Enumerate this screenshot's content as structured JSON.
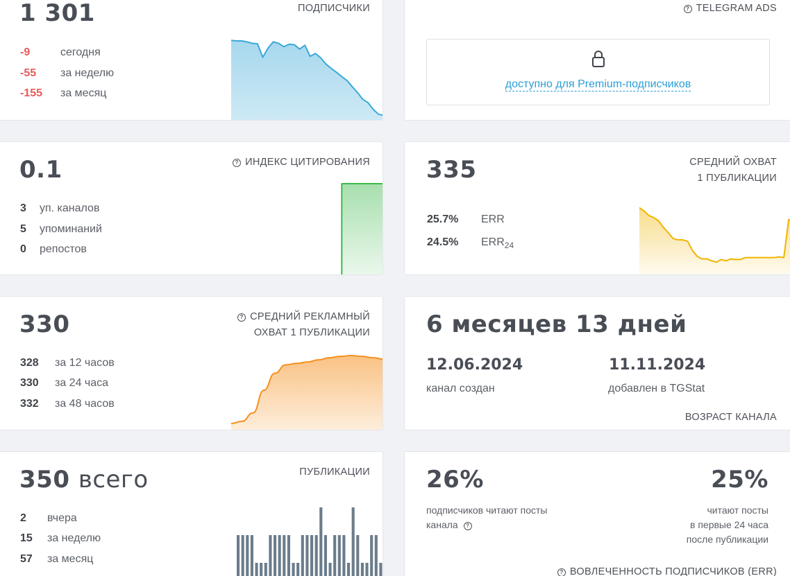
{
  "subscribers": {
    "value": "1 301",
    "label": "ПОДПИСЧИКИ",
    "rows": [
      {
        "value": "-9",
        "text": "сегодня"
      },
      {
        "value": "-55",
        "text": "за неделю"
      },
      {
        "value": "-155",
        "text": "за месяц"
      }
    ],
    "chart_color": "#3aa8d8"
  },
  "telegram_ads": {
    "label": "TELEGRAM ADS",
    "locked_icon": "lock-icon",
    "locked_text": "доступно для Premium-подписчиков"
  },
  "citation": {
    "value": "0.1",
    "label": "ИНДЕКС ЦИТИРОВАНИЯ",
    "rows": [
      {
        "value": "3",
        "text": "уп. каналов"
      },
      {
        "value": "5",
        "text": "упоминаний"
      },
      {
        "value": "0",
        "text": "репостов"
      }
    ],
    "chart_color": "#3cb84a"
  },
  "avg_reach": {
    "value": "335",
    "label_line1": "СРЕДНИЙ ОХВАТ",
    "label_line2": "1 ПУБЛИКАЦИИ",
    "rows": [
      {
        "value": "25.7%",
        "text": "ERR",
        "sub": ""
      },
      {
        "value": "24.5%",
        "text": "ERR",
        "sub": "24"
      }
    ],
    "chart_color": "#f0b400"
  },
  "ad_reach": {
    "value": "330",
    "label_line1": "СРЕДНИЙ РЕКЛАМНЫЙ",
    "label_line2": "ОХВАТ 1 ПУБЛИКАЦИИ",
    "rows": [
      {
        "value": "328",
        "text": "за 12 часов"
      },
      {
        "value": "330",
        "text": "за 24 часа"
      },
      {
        "value": "332",
        "text": "за 48 часов"
      }
    ],
    "chart_color": "#f5901e"
  },
  "channel_age": {
    "value": "6 месяцев 13 дней",
    "created_date": "12.06.2024",
    "created_label": "канал создан",
    "added_date": "11.11.2024",
    "added_label": "добавлен в TGStat",
    "label": "ВОЗРАСТ КАНАЛА"
  },
  "publications": {
    "value": "350",
    "value_suffix": "всего",
    "label": "ПУБЛИКАЦИИ",
    "rows": [
      {
        "value": "2",
        "text": "вчера"
      },
      {
        "value": "15",
        "text": "за неделю"
      },
      {
        "value": "57",
        "text": "за месяц"
      }
    ],
    "chart_color": "#6b7c8c"
  },
  "engagement": {
    "left_value": "26%",
    "left_text_line1": "подписчиков читают посты",
    "left_text_line2": "канала",
    "right_value": "25%",
    "right_text_line1": "читают посты",
    "right_text_line2": "в первые 24 часа",
    "right_text_line3": "после публикации",
    "label": "ВОВЛЕЧЕННОСТЬ ПОДПИСЧИКОВ (ERR)"
  },
  "chart_data": [
    {
      "type": "area",
      "name": "subscribers-trend",
      "y": [
        1456,
        1455,
        1455,
        1453,
        1450,
        1449,
        1421,
        1440,
        1453,
        1450,
        1443,
        1448,
        1447,
        1438,
        1446,
        1423,
        1429,
        1420,
        1407,
        1398,
        1390,
        1381,
        1373,
        1360,
        1348,
        1334,
        1327,
        1313,
        1303,
        1301
      ],
      "title": ""
    },
    {
      "type": "area",
      "name": "citation-trend",
      "y": [
        0,
        0,
        0,
        0,
        0,
        0,
        0,
        0,
        0,
        0,
        0,
        0,
        0,
        0,
        0,
        0,
        0,
        0,
        0,
        0,
        0,
        0.1,
        0.1,
        0.1,
        0.1,
        0.1,
        0.1,
        0.1,
        0.1,
        0.1
      ],
      "title": ""
    },
    {
      "type": "area",
      "name": "avg-reach-trend",
      "y": [
        445,
        440,
        433,
        430,
        425,
        415,
        407,
        398,
        396,
        396,
        394,
        380,
        371,
        367,
        367,
        364,
        362,
        366,
        364,
        367,
        366,
        366,
        369,
        369,
        369,
        369,
        369,
        369,
        369,
        370,
        369,
        427,
        426
      ],
      "title": ""
    },
    {
      "type": "area",
      "name": "ad-reach-trend",
      "y": [
        1,
        4,
        16,
        48,
        72,
        84,
        86,
        88,
        91,
        94,
        96,
        97,
        96,
        94,
        92
      ],
      "title": ""
    },
    {
      "type": "bar",
      "name": "publications-trend",
      "values": [
        3,
        3,
        3,
        3,
        1,
        1,
        1,
        3,
        3,
        3,
        3,
        3,
        1,
        1,
        3,
        3,
        3,
        3,
        5,
        3,
        1,
        3,
        3,
        3,
        1,
        5,
        3,
        1,
        1,
        3,
        3,
        1
      ],
      "title": ""
    }
  ]
}
